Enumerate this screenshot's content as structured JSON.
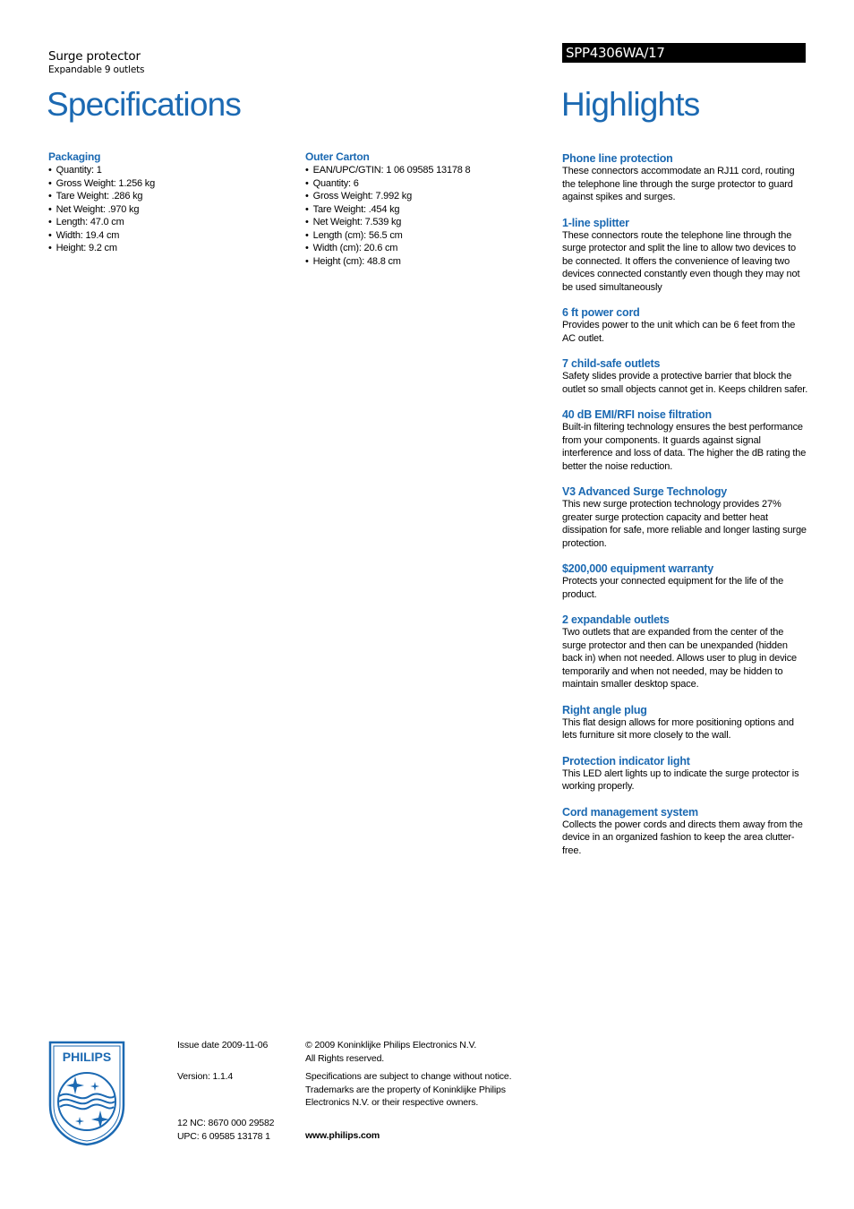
{
  "header": {
    "product_type": "Surge protector",
    "product_subtitle": "Expandable 9 outlets",
    "model_number": "SPP4306WA/17",
    "spec_title": "Specifications",
    "highlights_title": "Highlights"
  },
  "specifications": {
    "packaging": {
      "heading": "Packaging",
      "items": [
        "Quantity: 1",
        "Gross Weight: 1.256 kg",
        "Tare Weight: .286 kg",
        "Net Weight: .970 kg",
        "Length: 47.0 cm",
        "Width: 19.4 cm",
        "Height: 9.2 cm"
      ]
    },
    "outer_carton": {
      "heading": "Outer Carton",
      "items": [
        "EAN/UPC/GTIN: 1 06 09585 13178 8",
        "Quantity: 6",
        "Gross Weight: 7.992 kg",
        "Tare Weight: .454 kg",
        "Net Weight: 7.539 kg",
        "Length (cm): 56.5 cm",
        "Width (cm): 20.6 cm",
        "Height (cm): 48.8 cm"
      ]
    }
  },
  "highlights": [
    {
      "title": "Phone line protection",
      "text": "These connectors accommodate an RJ11 cord, routing the telephone line through the surge protector to guard against spikes and surges."
    },
    {
      "title": "1-line splitter",
      "text": "These connectors route the telephone line through the surge protector and split the line to allow two devices to be connected. It offers the convenience of leaving two devices connected constantly even though they may not be used simultaneously"
    },
    {
      "title": "6 ft power cord",
      "text": "Provides power to the unit which can be 6 feet from the AC outlet."
    },
    {
      "title": "7 child-safe outlets",
      "text": "Safety slides provide a protective barrier that block the outlet so small objects cannot get in. Keeps children safer."
    },
    {
      "title": "40 dB EMI/RFI noise filtration",
      "text": "Built-in filtering technology ensures the best performance from your components. It guards against signal interference and loss of data. The higher the dB rating the better the noise reduction."
    },
    {
      "title": "V3 Advanced Surge Technology",
      "text": "This new surge protection technology provides 27% greater surge protection capacity and better heat dissipation for safe, more reliable and longer lasting surge protection."
    },
    {
      "title": "$200,000 equipment warranty",
      "text": "Protects your connected equipment for the life of the product."
    },
    {
      "title": "2 expandable outlets",
      "text": "Two outlets that are expanded from the center of the surge protector and then can be unexpanded (hidden back in) when not needed. Allows user to plug in device temporarily and when not needed, may be hidden to maintain smaller desktop space."
    },
    {
      "title": "Right angle plug",
      "text": "This flat design allows for more positioning options and lets furniture sit more closely to the wall."
    },
    {
      "title": "Protection indicator light",
      "text": "This LED alert lights up to indicate the surge protector is working properly."
    },
    {
      "title": "Cord management system",
      "text": "Collects the power cords and directs them away from the device in an organized fashion to keep the area clutter-free."
    }
  ],
  "footer": {
    "logo_text": "PHILIPS",
    "issue_date": "Issue date 2009-11-06",
    "version": "Version: 1.1.4",
    "nc": "12 NC: 8670 000 29582",
    "upc": "UPC: 6 09585 13178 1",
    "copyright_line1": "© 2009 Koninklijke Philips Electronics N.V.",
    "copyright_line2": "All Rights reserved.",
    "disclaimer_line1": "Specifications are subject to change without notice.",
    "disclaimer_line2": "Trademarks are the property of Koninklijke Philips",
    "disclaimer_line3": "Electronics N.V. or their respective owners.",
    "website": "www.philips.com"
  },
  "colors": {
    "brand_blue": "#1b69b2",
    "model_bar": "#000000"
  }
}
